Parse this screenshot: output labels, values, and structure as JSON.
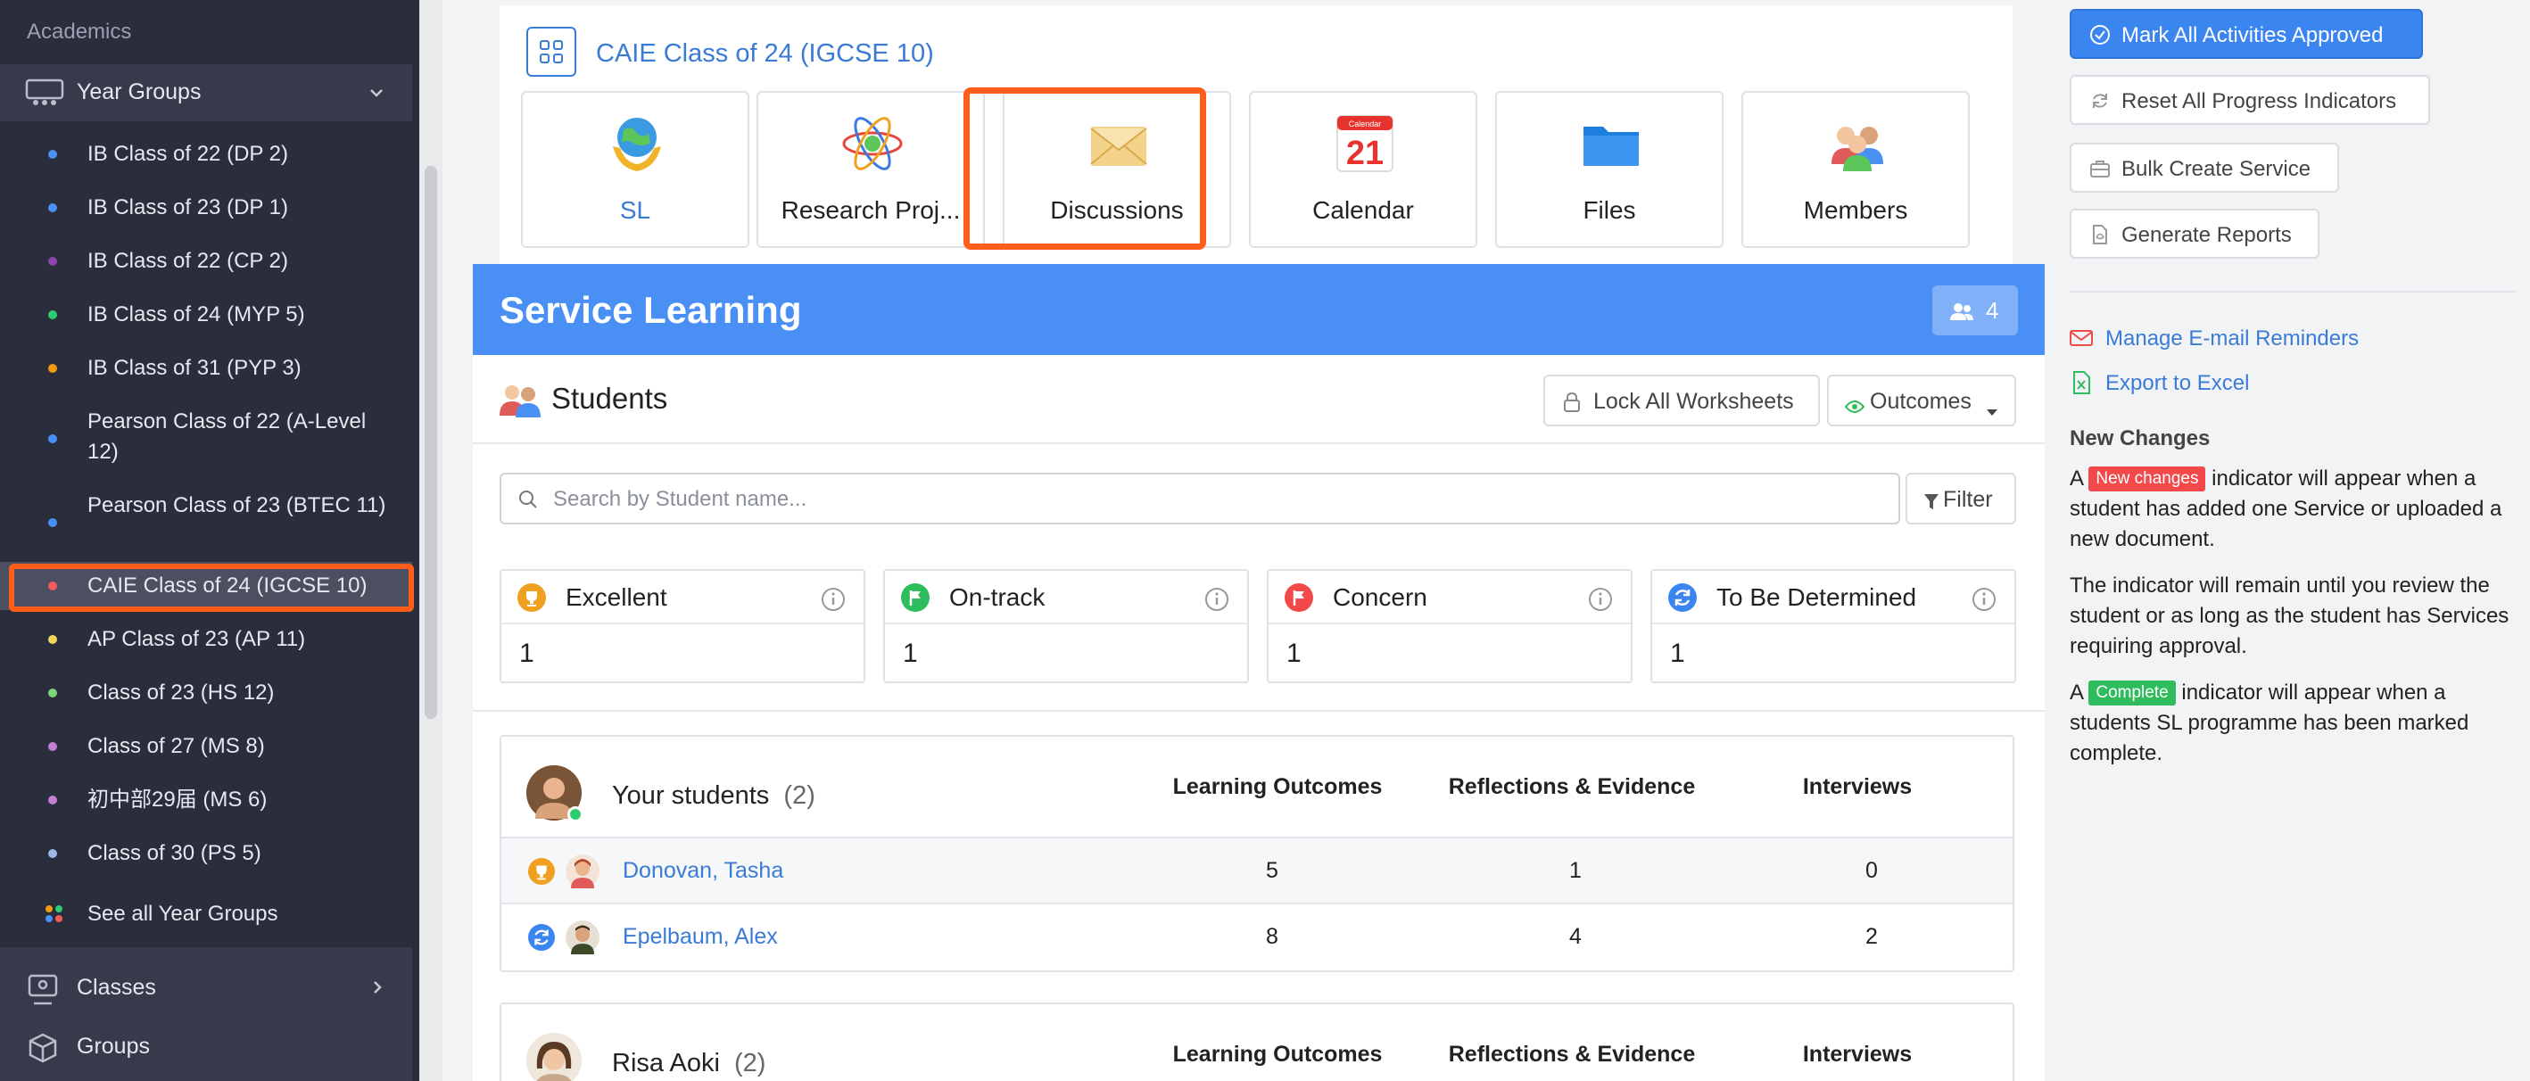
{
  "sidebar": {
    "section_label": "Academics",
    "year_groups_label": "Year Groups",
    "items": [
      {
        "label": "IB Class of 22 (DP 2)",
        "dot": "#4a90f4"
      },
      {
        "label": "IB Class of 23 (DP 1)",
        "dot": "#4a90f4"
      },
      {
        "label": "IB Class of 22 (CP 2)",
        "dot": "#8e44ad"
      },
      {
        "label": "IB Class of 24 (MYP 5)",
        "dot": "#2ecc71"
      },
      {
        "label": "IB Class of 31 (PYP 3)",
        "dot": "#f39c12"
      },
      {
        "label": "Pearson Class of 22 (A-Level 12)",
        "dot": "#4a90f4"
      },
      {
        "label": "Pearson Class of 23 (BTEC 11)",
        "dot": "#4a90f4"
      },
      {
        "label": "CAIE Class of 24 (IGCSE 10)",
        "dot": "#f25c5c"
      },
      {
        "label": "AP Class of 23 (AP 11)",
        "dot": "#f1d75a"
      },
      {
        "label": "Class of 23 (HS 12)",
        "dot": "#7bd67b"
      },
      {
        "label": "Class of 27 (MS 8)",
        "dot": "#c27fd6"
      },
      {
        "label": "初中部29届 (MS 6)",
        "dot": "#c27fd6"
      },
      {
        "label": "Class of 30 (PS 5)",
        "dot": "#9db9e8"
      }
    ],
    "see_all_label": "See all Year Groups",
    "classes_label": "Classes",
    "groups_label": "Groups"
  },
  "apps": {
    "title": "CAIE Class of 24 (IGCSE 10)",
    "tiles": [
      {
        "label": "SL",
        "icon": "globe-hands-icon"
      },
      {
        "label": "Research Proj...",
        "icon": "atom-icon"
      },
      {
        "label": "Discussions",
        "icon": "envelope-icon"
      },
      {
        "label": "Calendar",
        "icon": "calendar-icon",
        "day": "21",
        "month_label": "Calendar"
      },
      {
        "label": "Files",
        "icon": "folder-icon"
      },
      {
        "label": "Members",
        "icon": "people-icon"
      }
    ]
  },
  "service_learning": {
    "title": "Service Learning",
    "member_count": "4",
    "students_label": "Students",
    "lock_label": "Lock All Worksheets",
    "outcomes_label": "Outcomes",
    "search_placeholder": "Search by Student name...",
    "filter_label": "Filter",
    "stats": [
      {
        "name": "Excellent",
        "value": "1",
        "color": "#f0a020",
        "icon": "trophy-icon"
      },
      {
        "name": "On-track",
        "value": "1",
        "color": "#2ebc5c",
        "icon": "flag-icon"
      },
      {
        "name": "Concern",
        "value": "1",
        "color": "#f24a4a",
        "icon": "flag-icon"
      },
      {
        "name": "To Be Determined",
        "value": "1",
        "color": "#3a85f0",
        "icon": "refresh-icon"
      }
    ],
    "columns": [
      "Learning Outcomes",
      "Reflections & Evidence",
      "Interviews"
    ],
    "groups": [
      {
        "name": "Your students",
        "count": "(2)",
        "rows": [
          {
            "name": "Donovan, Tasha",
            "status": "trophy-icon",
            "status_color": "#f0a020",
            "lo": "5",
            "re": "1",
            "iv": "0"
          },
          {
            "name": "Epelbaum, Alex",
            "status": "refresh-icon",
            "status_color": "#3a85f0",
            "lo": "8",
            "re": "4",
            "iv": "2"
          }
        ]
      },
      {
        "name": "Risa Aoki",
        "count": "(2)",
        "rows": []
      }
    ]
  },
  "right_panel": {
    "approve_label": "Mark All Activities Approved",
    "reset_label": "Reset All Progress Indicators",
    "bulk_label": "Bulk Create Service",
    "reports_label": "Generate Reports",
    "email_label": "Manage E-mail Reminders",
    "excel_label": "Export to Excel",
    "new_changes_heading": "New Changes",
    "p1_a": "A",
    "p1_tag": "New changes",
    "p1_b": "indicator will appear when a student has added one Service or uploaded a new document.",
    "p2": "The indicator will remain until you review the student or as long as the student has Services requiring approval.",
    "p3_a": "A",
    "p3_tag": "Complete",
    "p3_b": "indicator will appear when a students SL programme has been marked complete."
  }
}
